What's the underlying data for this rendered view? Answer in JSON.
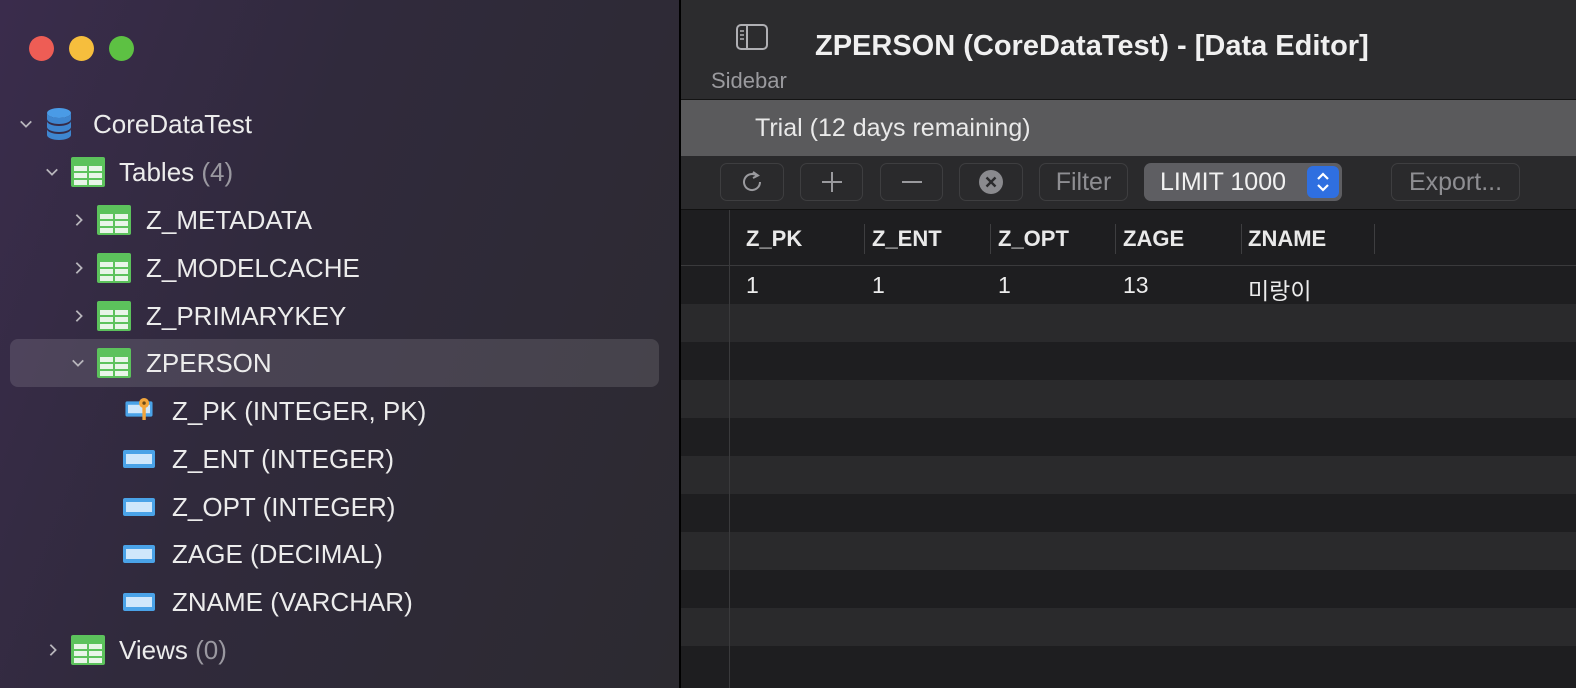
{
  "sidebar": {
    "database": {
      "label": "CoreDataTest"
    },
    "tables_group": {
      "label": "Tables",
      "count": "(4)"
    },
    "tables": [
      {
        "label": "Z_METADATA"
      },
      {
        "label": "Z_MODELCACHE"
      },
      {
        "label": "Z_PRIMARYKEY"
      },
      {
        "label": "ZPERSON"
      }
    ],
    "columns": [
      {
        "label": "Z_PK (INTEGER, PK)",
        "icon": "primary-key-column-icon"
      },
      {
        "label": "Z_ENT (INTEGER)",
        "icon": "column-icon"
      },
      {
        "label": "Z_OPT (INTEGER)",
        "icon": "column-icon"
      },
      {
        "label": "ZAGE (DECIMAL)",
        "icon": "column-icon"
      },
      {
        "label": "ZNAME (VARCHAR)",
        "icon": "column-icon"
      }
    ],
    "views_group": {
      "label": "Views",
      "count": "(0)"
    }
  },
  "titlebar": {
    "sidebar_button_label": "Sidebar",
    "title": "ZPERSON (CoreDataTest) - [Data Editor]"
  },
  "trial": {
    "text": "Trial (12 days remaining)"
  },
  "toolbar": {
    "filter_label": "Filter",
    "limit_label": "LIMIT 1000",
    "export_label": "Export..."
  },
  "grid": {
    "columns": [
      "Z_PK",
      "Z_ENT",
      "Z_OPT",
      "ZAGE",
      "ZNAME"
    ],
    "rows": [
      [
        "1",
        "1",
        "1",
        "13",
        "미랑이"
      ]
    ]
  },
  "colors": {
    "close": "#ee5d55",
    "minimize": "#f6be3d",
    "maximize": "#5dc143",
    "accent": "#2f6fe0",
    "table_icon": "#5cc25c",
    "column_icon": "#4aa3e8"
  }
}
